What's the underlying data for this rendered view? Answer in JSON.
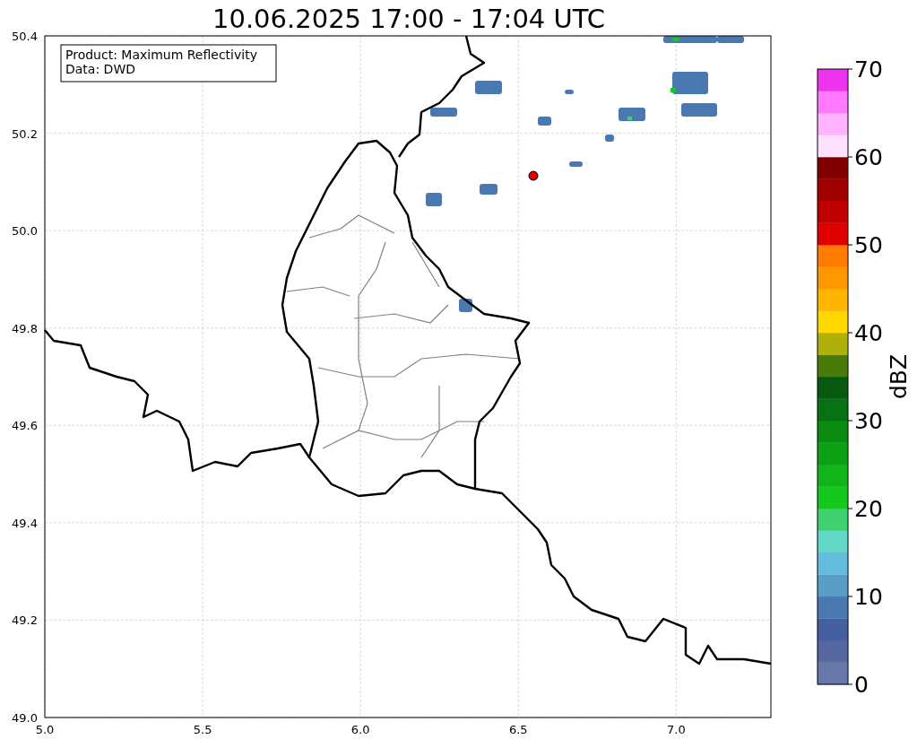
{
  "title": "10.06.2025 17:00 - 17:04 UTC",
  "info_box": {
    "lines": [
      "Product: Maximum Reflectivity",
      "Data: DWD"
    ]
  },
  "map": {
    "xticks": [
      "5.0",
      "5.5",
      "6.0",
      "6.5",
      "7.0"
    ],
    "yticks": [
      "50.4",
      "50.2",
      "50.0",
      "49.8",
      "49.6",
      "49.4",
      "49.2",
      "49.0"
    ]
  },
  "colorbar": {
    "label": "dBZ",
    "ticks": [
      "70",
      "60",
      "50",
      "40",
      "30",
      "20",
      "10",
      "0"
    ],
    "segments": [
      {
        "color": "#6677aa"
      },
      {
        "color": "#5566a0"
      },
      {
        "color": "#4460a0"
      },
      {
        "color": "#4a78b0"
      },
      {
        "color": "#5a9ec8"
      },
      {
        "color": "#64bcdc"
      },
      {
        "color": "#64d8c8"
      },
      {
        "color": "#40d070"
      },
      {
        "color": "#14c81e"
      },
      {
        "color": "#12b41a"
      },
      {
        "color": "#0ea014"
      },
      {
        "color": "#0a8c10"
      },
      {
        "color": "#087212"
      },
      {
        "color": "#065a0e"
      },
      {
        "color": "#4a7a0a"
      },
      {
        "color": "#b0b00a"
      },
      {
        "color": "#ffd800"
      },
      {
        "color": "#ffb400"
      },
      {
        "color": "#ff9800"
      },
      {
        "color": "#ff7c00"
      },
      {
        "color": "#e00000"
      },
      {
        "color": "#c00000"
      },
      {
        "color": "#a00000"
      },
      {
        "color": "#800000"
      },
      {
        "color": "#ffe0ff"
      },
      {
        "color": "#ffb4ff"
      },
      {
        "color": "#ff78ff"
      },
      {
        "color": "#ee33ee"
      }
    ]
  }
}
